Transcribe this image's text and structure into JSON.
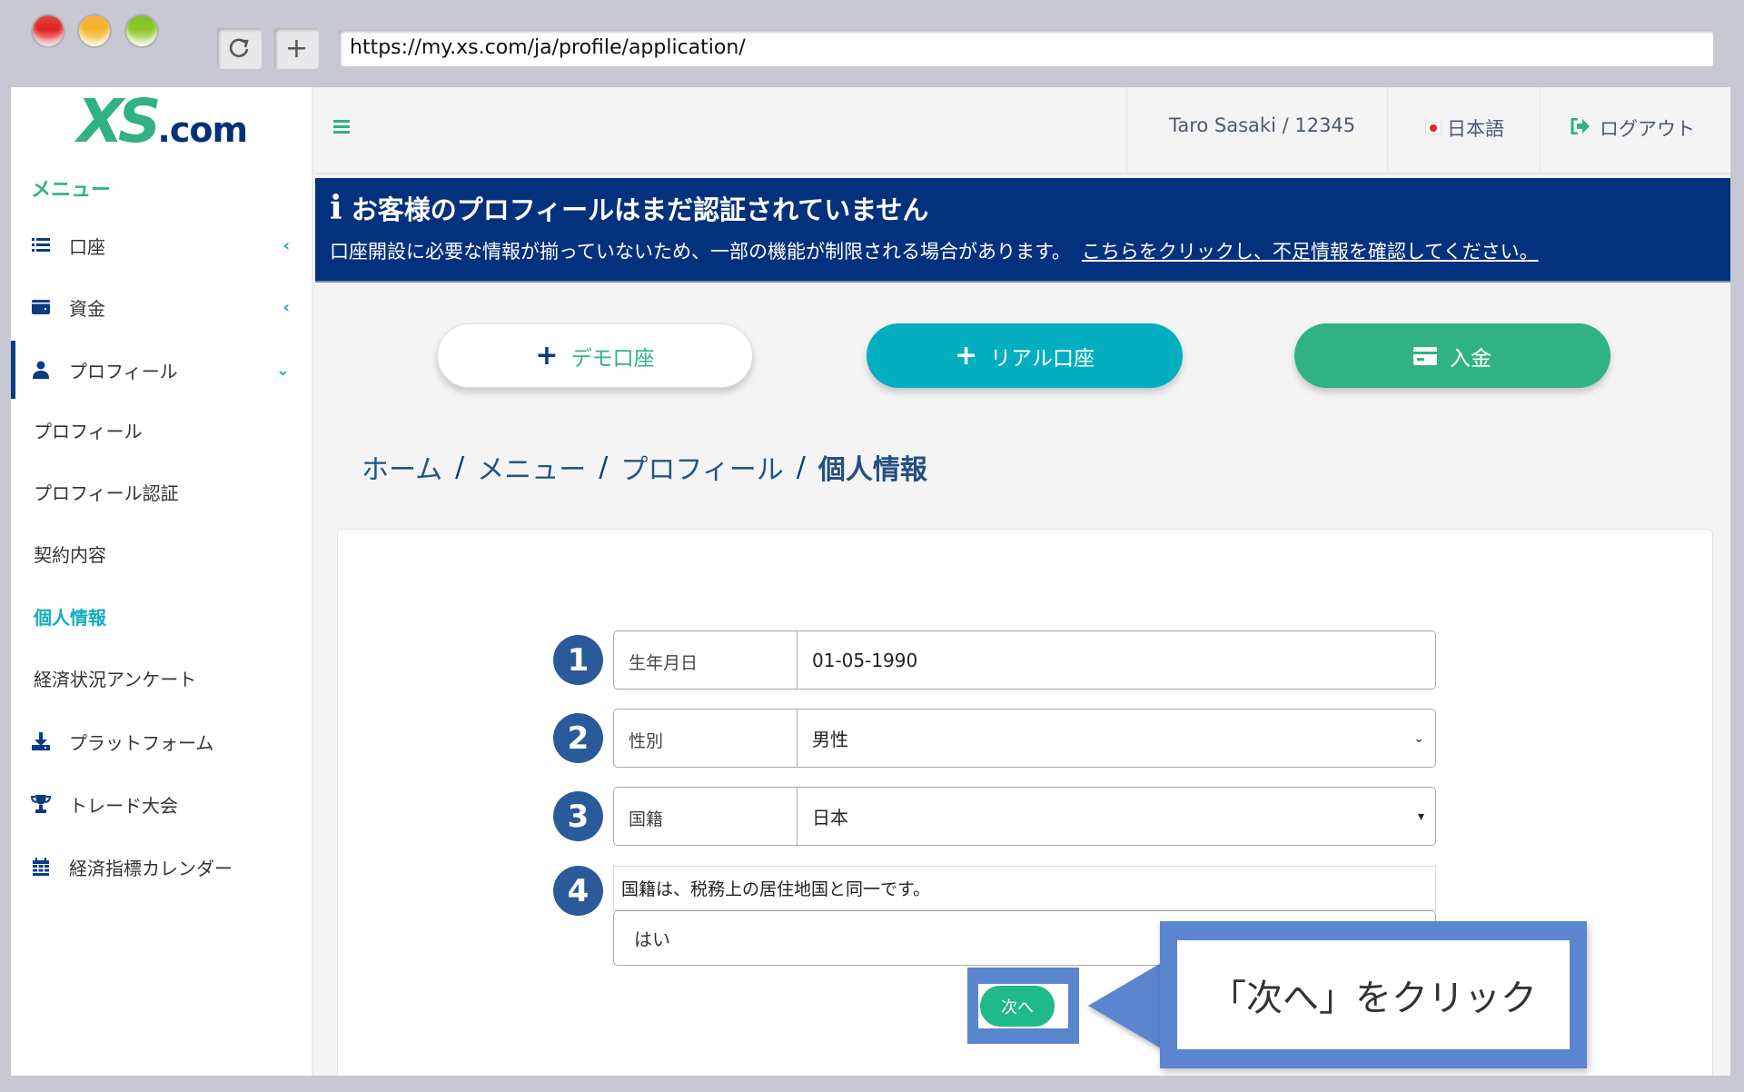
{
  "browser": {
    "url": "https://my.xs.com/ja/profile/application/",
    "reload_icon": "reload-icon",
    "new_tab_icon": "plus-icon"
  },
  "logo": {
    "primary": "XS",
    "suffix": ".com"
  },
  "sidebar": {
    "menu_title": "メニュー",
    "items": [
      {
        "label": "口座",
        "icon": "list-icon",
        "chevron": "‹"
      },
      {
        "label": "資金",
        "icon": "wallet-icon",
        "chevron": "‹"
      },
      {
        "label": "プロフィール",
        "icon": "user-icon",
        "chevron": "⌄"
      },
      {
        "label": "プラットフォーム",
        "icon": "download-icon"
      },
      {
        "label": "トレード大会",
        "icon": "trophy-icon"
      },
      {
        "label": "経済指標カレンダー",
        "icon": "calendar-icon"
      }
    ],
    "sub_items": [
      {
        "label": "プロフィール"
      },
      {
        "label": "プロフィール認証"
      },
      {
        "label": "契約内容"
      },
      {
        "label": "個人情報"
      },
      {
        "label": "経済状況アンケート"
      }
    ]
  },
  "header": {
    "user": "Taro Sasaki / 12345",
    "language": "日本語",
    "logout": "ログアウト"
  },
  "banner": {
    "title": "お客様のプロフィールはまだ認証されていません",
    "text": "口座開設に必要な情報が揃っていないため、一部の機能が制限される場合があります。",
    "link": "こちらをクリックし、不足情報を確認してください。"
  },
  "actions": {
    "demo": "デモ口座",
    "real": "リアル口座",
    "deposit": "入金",
    "plus": "+"
  },
  "breadcrumb": {
    "items": [
      "ホーム",
      "メニュー",
      "プロフィール"
    ],
    "current": "個人情報",
    "separator": "/"
  },
  "form": {
    "rows": [
      {
        "badge": "1",
        "label": "生年月日",
        "value": "01-05-1990"
      },
      {
        "badge": "2",
        "label": "性別",
        "value": "男性",
        "arrow": "⌄"
      },
      {
        "badge": "3",
        "label": "国籍",
        "value": "日本",
        "arrow": "▾"
      }
    ],
    "question": {
      "badge": "4",
      "text": "国籍は、税務上の居住地国と同一です。",
      "value": "はい"
    },
    "next_label": "次へ"
  },
  "callout": {
    "text": "「次へ」をクリック"
  }
}
